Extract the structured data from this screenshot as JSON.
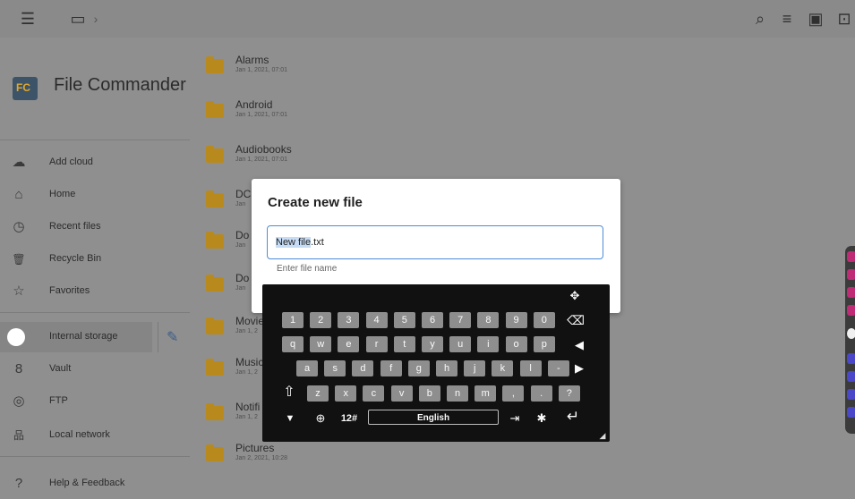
{
  "topbar": {
    "menu_icon": "hamburger-icon",
    "breadcrumb_device": "device-icon",
    "breadcrumb_sep": "›",
    "actions": [
      "search-icon",
      "sort-icon",
      "new-file-icon",
      "new-folder-icon"
    ]
  },
  "drawer": {
    "app_name": "File Commander",
    "logo_text": "FC",
    "items": [
      {
        "label": "Add cloud",
        "icon": "cloud-icon",
        "glyph": "☁"
      },
      {
        "label": "Home",
        "icon": "home-icon",
        "glyph": "⌂"
      },
      {
        "label": "Recent files",
        "icon": "clock-icon",
        "glyph": "◷"
      },
      {
        "label": "Recycle Bin",
        "icon": "trash-icon",
        "glyph": "🗑"
      },
      {
        "label": "Favorites",
        "icon": "star-icon",
        "glyph": "☆"
      },
      {
        "label": "Internal storage",
        "icon": "storage-icon",
        "glyph": "◯"
      },
      {
        "label": "Vault",
        "icon": "vault-icon",
        "glyph": "8"
      },
      {
        "label": "FTP",
        "icon": "globe-icon",
        "glyph": "◎"
      },
      {
        "label": "Local network",
        "icon": "network-icon",
        "glyph": "品"
      },
      {
        "label": "Help & Feedback",
        "icon": "help-icon",
        "glyph": "?"
      }
    ]
  },
  "files": [
    {
      "name": "Alarms",
      "date": "Jan 1, 2021, 07:01"
    },
    {
      "name": "Android",
      "date": "Jan 1, 2021, 07:01"
    },
    {
      "name": "Audiobooks",
      "date": "Jan 1, 2021, 07:01"
    },
    {
      "name": "DC",
      "date": "Jan"
    },
    {
      "name": "Do",
      "date": "Jan"
    },
    {
      "name": "Do",
      "date": "Jan"
    },
    {
      "name": "Movie",
      "date": "Jan 1, 2"
    },
    {
      "name": "Music",
      "date": "Jan 1, 2"
    },
    {
      "name": "Notifi",
      "date": "Jan 1, 2"
    },
    {
      "name": "Pictures",
      "date": "Jan 2, 2021, 10:28"
    }
  ],
  "dialog": {
    "title": "Create new file",
    "filename_selected": "New file",
    "filename_ext": ".txt",
    "hint": "Enter file name"
  },
  "keyboard": {
    "row1": [
      "1",
      "2",
      "3",
      "4",
      "5",
      "6",
      "7",
      "8",
      "9",
      "0"
    ],
    "row2": [
      "q",
      "w",
      "e",
      "r",
      "t",
      "y",
      "u",
      "i",
      "o",
      "p"
    ],
    "row3": [
      "a",
      "s",
      "d",
      "f",
      "g",
      "h",
      "j",
      "k",
      "l",
      "-"
    ],
    "row4": [
      "z",
      "x",
      "c",
      "v",
      "b",
      "n",
      "m",
      ",",
      ".",
      "?"
    ],
    "symbols_label": "12#",
    "space_label": "English",
    "backspace_glyph": "⌫",
    "left_glyph": "◀",
    "right_glyph": "▶",
    "shift_glyph": "⇧",
    "hide_glyph": "▼",
    "globe_glyph": "⊕",
    "settings_glyph": "✱",
    "enter_glyph": "↵",
    "tab_glyph": "⇥",
    "move_glyph": "✥",
    "resize_glyph": "◢"
  },
  "colors": {
    "accent": "#4b8ed6",
    "folder": "#b88a1e"
  }
}
